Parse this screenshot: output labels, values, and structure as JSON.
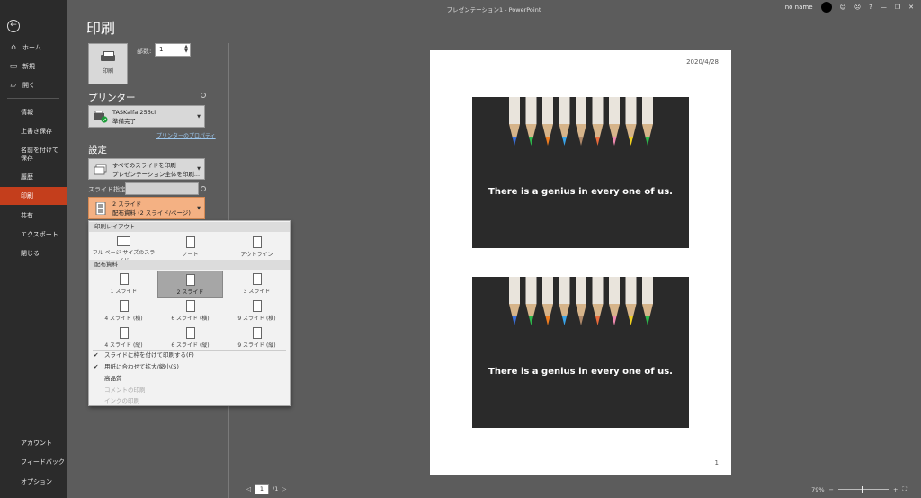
{
  "window": {
    "title": "プレゼンテーション1  -  PowerPoint",
    "user": "no name",
    "help": "?"
  },
  "nav": {
    "items": [
      {
        "label": "ホーム",
        "icon": "home-icon"
      },
      {
        "label": "新規",
        "icon": "new-document-icon"
      },
      {
        "label": "開く",
        "icon": "folder-open-icon"
      },
      {
        "label": "情報"
      },
      {
        "label": "上書き保存"
      },
      {
        "label": "名前を付けて保存"
      },
      {
        "label": "履歴"
      },
      {
        "label": "印刷"
      },
      {
        "label": "共有"
      },
      {
        "label": "エクスポート"
      },
      {
        "label": "閉じる"
      }
    ],
    "bottom": [
      {
        "label": "アカウント"
      },
      {
        "label": "フィードバック"
      },
      {
        "label": "オプション"
      }
    ],
    "active_label": "印刷"
  },
  "print": {
    "heading": "印刷",
    "button_label": "印刷",
    "copies_label": "部数:",
    "copies_value": "1",
    "printer_heading": "プリンター",
    "printer_name": "TASKalfa 256ci",
    "printer_status": "準備完了",
    "printer_props": "プリンターのプロパティ",
    "settings_heading": "設定",
    "range_line1": "すべてのスライドを印刷",
    "range_line2": "プレゼンテーション全体を印刷...",
    "slides_label": "スライド指定:",
    "layout_line1": "2 スライド",
    "layout_line2": "配布資料 (2 スライド/ページ)"
  },
  "menu": {
    "section_layout": "印刷レイアウト",
    "layout_options": [
      "フル ページ サイズのスライド",
      "ノート",
      "アウトライン"
    ],
    "section_handouts": "配布資料",
    "handout_options": [
      "1 スライド",
      "2 スライド",
      "3 スライド",
      "4 スライド (横)",
      "6 スライド (横)",
      "9 スライド (横)",
      "4 スライド (縦)",
      "6 スライド (縦)",
      "9 スライド (縦)"
    ],
    "selected_handout": "2 スライド",
    "checks": [
      {
        "label": "スライドに枠を付けて印刷する(F)",
        "checked": true
      },
      {
        "label": "用紙に合わせて拡大/縮小(S)",
        "checked": true
      },
      {
        "label": "高品質",
        "checked": false
      },
      {
        "label": "コメントの印刷",
        "checked": false,
        "disabled": true
      },
      {
        "label": "インクの印刷",
        "checked": false,
        "disabled": true
      }
    ]
  },
  "preview": {
    "date": "2020/4/28",
    "page_number": "1",
    "slide_caption": "There is a genius in every one of us.",
    "pencil_tip_colors": [
      "#3a6fd8",
      "#2db84b",
      "#f07c1e",
      "#3aa3e8",
      "#b08a6a",
      "#e86a3a",
      "#f08ab0",
      "#f0d020",
      "#2db84b"
    ]
  },
  "footer": {
    "current_page": "1",
    "total_pages": "/1",
    "zoom": "79%"
  }
}
